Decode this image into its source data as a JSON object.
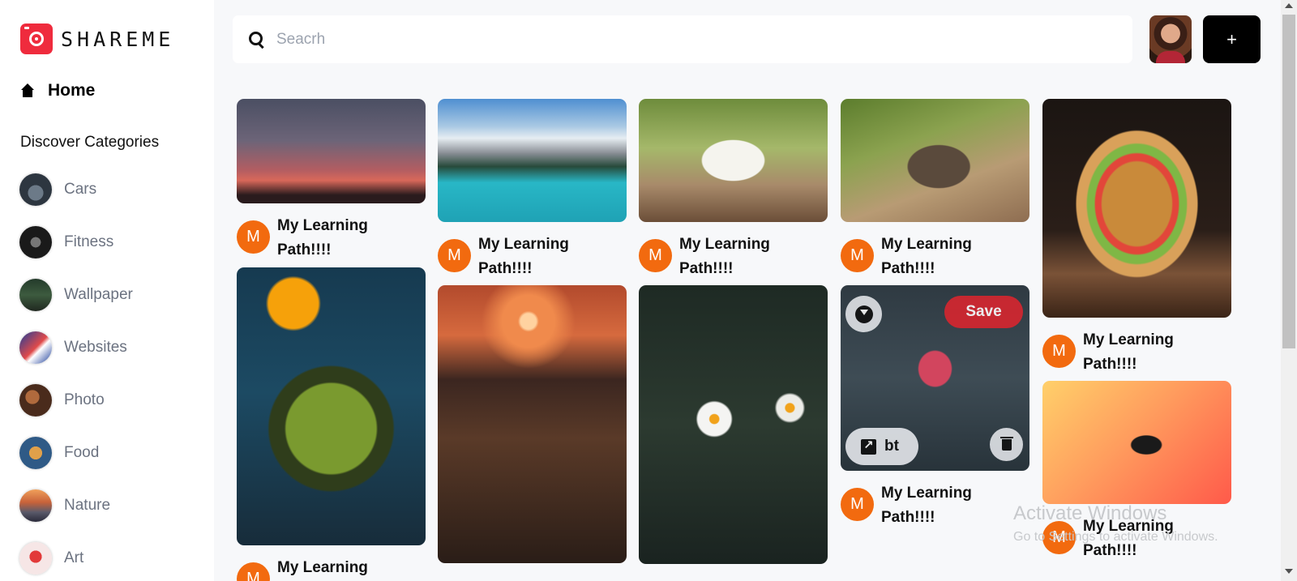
{
  "brand": {
    "name": "SHAREME"
  },
  "sidebar": {
    "home_label": "Home",
    "discover_heading": "Discover Categories",
    "categories": [
      {
        "label": "Cars"
      },
      {
        "label": "Fitness"
      },
      {
        "label": "Wallpaper"
      },
      {
        "label": "Websites"
      },
      {
        "label": "Photo"
      },
      {
        "label": "Food"
      },
      {
        "label": "Nature"
      },
      {
        "label": "Art"
      }
    ]
  },
  "header": {
    "search_placeholder": "Seacrh",
    "search_value": "",
    "add_label": "+"
  },
  "pins": [
    {
      "author_initial": "M",
      "author_name": "My Learning Path!!!!"
    },
    {
      "author_initial": "M",
      "author_name": "My Learning Path!!!!"
    },
    {
      "author_initial": "M",
      "author_name": "My Learning Path!!!!"
    },
    {
      "author_initial": "M",
      "author_name": "My Learning Path!!!!"
    },
    {
      "author_initial": "M",
      "author_name": "My Learning Path!!!!"
    },
    {
      "author_initial": "M",
      "author_name": "My Learning Path!!!!"
    },
    {
      "author_initial": "M",
      "author_name": "My Learning Path!!!!"
    },
    {
      "author_initial": "M",
      "author_name": "My Learning Path!!!!"
    }
  ],
  "hovered_pin": {
    "save_label": "Save",
    "link_label": "bt"
  },
  "watermark": {
    "line1": "Activate Windows",
    "line2": "Go to Settings to activate Windows."
  },
  "colors": {
    "brand_red": "#ef2b3d",
    "author_orange": "#f26a0f",
    "save_red": "#d7262f"
  }
}
